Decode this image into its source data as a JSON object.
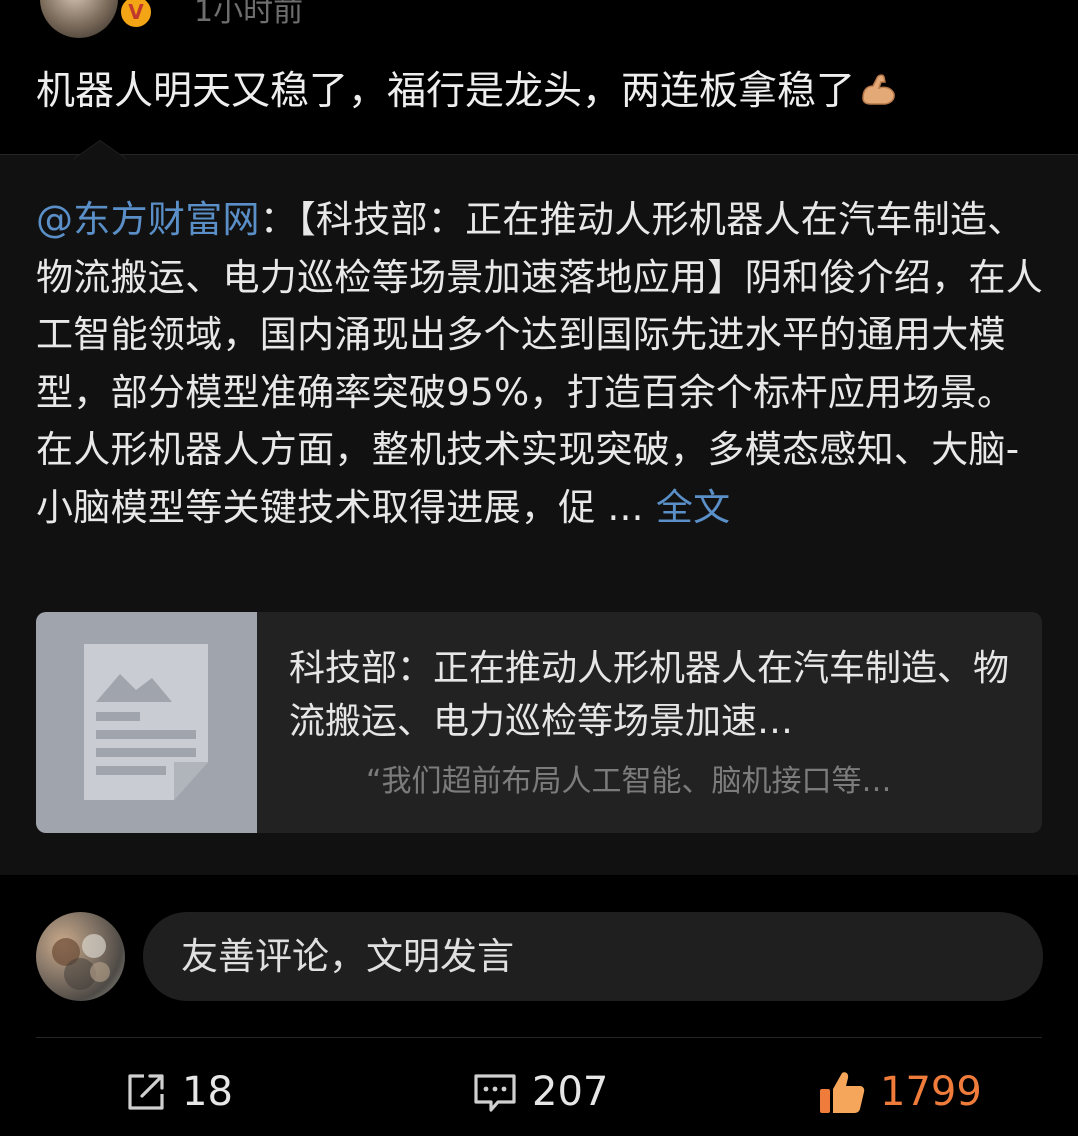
{
  "header": {
    "time": "1小时前"
  },
  "post": {
    "text": "机器人明天又稳了，福行是龙头，两连板拿稳了",
    "emoji": "flexed-biceps-emoji"
  },
  "repost": {
    "mention": "@东方财富网",
    "body": "：【科技部：正在推动人形机器人在汽车制造、物流搬运、电力巡检等场景加速落地应用】阴和俊介绍，在人工智能领域，国内涌现出多个达到国际先进水平的通用大模型，部分模型准确率突破95%，打造百余个标杆应用场景。在人形机器人方面，整机技术实现突破，多模态感知、大脑-小脑模型等关键技术取得进展，促 ... ",
    "full_text_link": "全文"
  },
  "link_card": {
    "title": "科技部：正在推动人形机器人在汽车制造、物流搬运、电力巡检等场景加速…",
    "subtitle": "“我们超前布局人工智能、脑机接口等…"
  },
  "comment": {
    "placeholder": "友善评论，文明发言"
  },
  "actions": {
    "share_count": "18",
    "comment_count": "207",
    "like_count": "1799"
  },
  "colors": {
    "background": "#000000",
    "link_blue": "#5a8fc8",
    "like_orange": "#f07c3c",
    "card_bg": "#222222"
  }
}
